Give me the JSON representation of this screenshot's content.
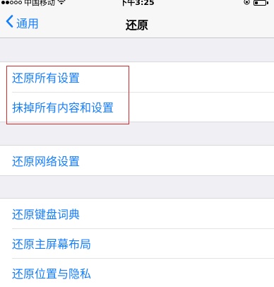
{
  "status_bar": {
    "carrier": "中国移动",
    "time": "下午3:25",
    "battery_level_percent": 25
  },
  "nav": {
    "back_label": "通用",
    "title": "还原"
  },
  "groups": [
    {
      "items": [
        {
          "label": "还原所有设置"
        },
        {
          "label": "抹掉所有内容和设置"
        }
      ]
    },
    {
      "items": [
        {
          "label": "还原网络设置"
        }
      ]
    },
    {
      "items": [
        {
          "label": "还原键盘词典"
        },
        {
          "label": "还原主屏幕布局"
        },
        {
          "label": "还原位置与隐私"
        }
      ]
    }
  ],
  "colors": {
    "accent": "#157efb",
    "highlight": "#d92b2b",
    "background": "#efeff4"
  }
}
